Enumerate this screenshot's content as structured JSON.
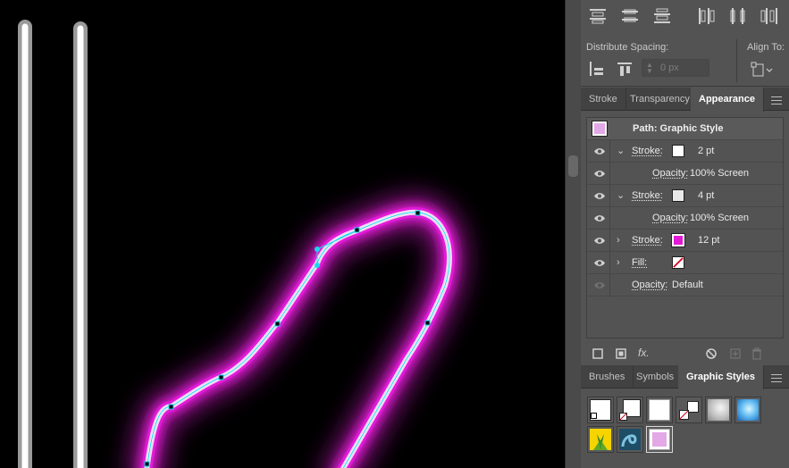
{
  "align_panel": {
    "distribute_spacing_label": "Distribute Spacing:",
    "align_to_label": "Align To:",
    "spacing_value": "0 px",
    "buttons": [
      "vertical-distribute-top",
      "vertical-distribute-center",
      "vertical-distribute-bottom",
      "horizontal-distribute-left",
      "horizontal-distribute-center",
      "horizontal-distribute-right"
    ]
  },
  "appearance_tabs": {
    "tabs": [
      {
        "label": "Stroke",
        "active": false
      },
      {
        "label": "Transparency",
        "active": false
      },
      {
        "label": "Appearance",
        "active": true
      }
    ]
  },
  "appearance": {
    "title": "Path: Graphic Style",
    "rows": [
      {
        "name": "Stroke:",
        "swatch": "#ffffff",
        "value": "2 pt",
        "expanded": true
      },
      {
        "name": "Opacity:",
        "value": "100% Screen",
        "indent": true
      },
      {
        "name": "Stroke:",
        "swatch": "#e8e8e8",
        "value": "4 pt",
        "expanded": true
      },
      {
        "name": "Opacity:",
        "value": "100% Screen",
        "indent": true
      },
      {
        "name": "Stroke:",
        "swatch": "#e21ad6",
        "value": "12 pt",
        "expanded": false
      },
      {
        "name": "Fill:",
        "swatch": "none",
        "value": "",
        "expanded": false
      },
      {
        "name": "Opacity:",
        "value": "Default",
        "indent": false,
        "dim_eye": true
      }
    ],
    "footer_icons": [
      "new-stroke-icon",
      "new-fill-icon",
      "fx-icon",
      "clear-appearance-icon",
      "duplicate-item-icon",
      "delete-item-icon"
    ],
    "fx_label": "fx."
  },
  "styles_tabs": {
    "tabs": [
      {
        "label": "Brushes",
        "active": false
      },
      {
        "label": "Symbols",
        "active": false
      },
      {
        "label": "Graphic Styles",
        "active": true
      }
    ]
  },
  "colors": {
    "neon": "#e21ad6",
    "selection": "#17d9ee",
    "panel_bg": "#535353"
  }
}
